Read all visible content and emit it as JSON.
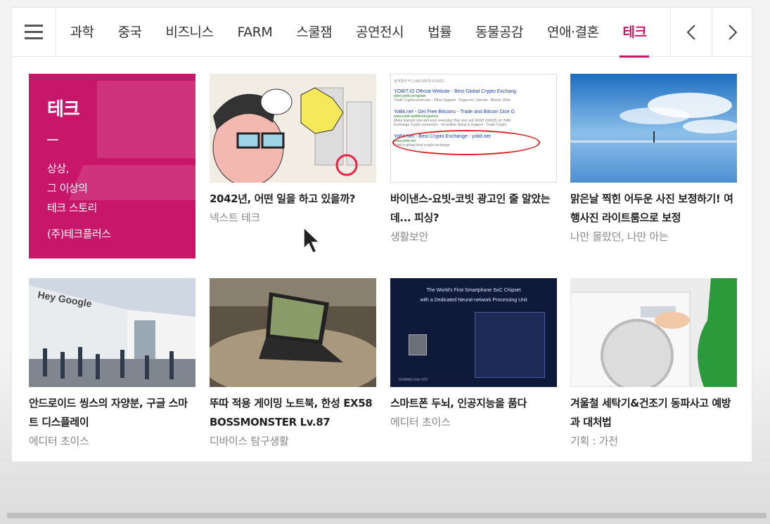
{
  "nav": {
    "tabs": [
      "과학",
      "중국",
      "비즈니스",
      "FARM",
      "스쿨잼",
      "공연전시",
      "법률",
      "동물공감",
      "연애·결혼",
      "테크"
    ],
    "active_index": 9
  },
  "feature": {
    "title": "테크",
    "lines": [
      "상상,",
      "그 이상의",
      "테크 스토리"
    ],
    "company": "(주)테크플러스",
    "color": "#c8166a"
  },
  "cards": [
    {
      "title": "2042년, 어떤 일을 하고 있을까?",
      "sub": "넥스트 테크"
    },
    {
      "title": "바이낸스-요빗-코빗 광고인 줄 알았는데... 피싱?",
      "sub": "생활보안"
    },
    {
      "title": "맑은날 찍힌 어두운 사진 보정하기! 여행사진 라이트룸으로 보정",
      "sub": "나만 몰랐던, 나만 아는"
    },
    {
      "title": "안드로이드 씽스의 자양분, 구글 스마트 디스플레이",
      "sub": "에디터 초이스"
    },
    {
      "title": "뚜따 적용 게이밍 노트북, 한성 EX58 BOSSMONSTER Lv.87",
      "sub": "디바이스 탐구생활"
    },
    {
      "title": "스마트폰 두뇌, 인공지능을 품다",
      "sub": "에디터 초이스"
    },
    {
      "title": "겨울철 세탁기&건조기 동파사고 예방과 대처법",
      "sub": "기획 : 가전"
    }
  ],
  "thumb_text": {
    "search_count": "검색결과 약 1,450,000개 (0.55초)",
    "ad1_title": "YOBIT.IO Official Website - Best Global Crypto Exchang",
    "ad1_url": "www.yobit.io/register",
    "ad1_desc": "Trade Cryptocurrencies · 24hrs Support · Dogecoin, Litecoin · Bitcoin, Ethe",
    "ad2_title": "YoBit.net - Get Free Bitcoins - Trade and Bitcoin Dice G",
    "ad2_url": "www.yobit.net/bitcoin/games",
    "ad2_desc": "Make deposit now and earn everyday! Buy and sell DASH (DASH) on YoBit",
    "ad2_desc2": "Exchange Crypto currencies · Incredible Setup & Support · Trade Crypto",
    "ad3_title": "YoBit Net - Best Crypto Exchange - yobit.net",
    "ad3_url": "www.yobit.net",
    "ad3_desc": "Yobit is global best crypto exchange",
    "google_sign": "Hey Google",
    "chip_line1": "The World's First Smartphone SoC Chipset",
    "chip_line2": "with a Dedicated Neural-network Processing Unit",
    "chip_brand": "HUAWEI Kirin 970"
  }
}
